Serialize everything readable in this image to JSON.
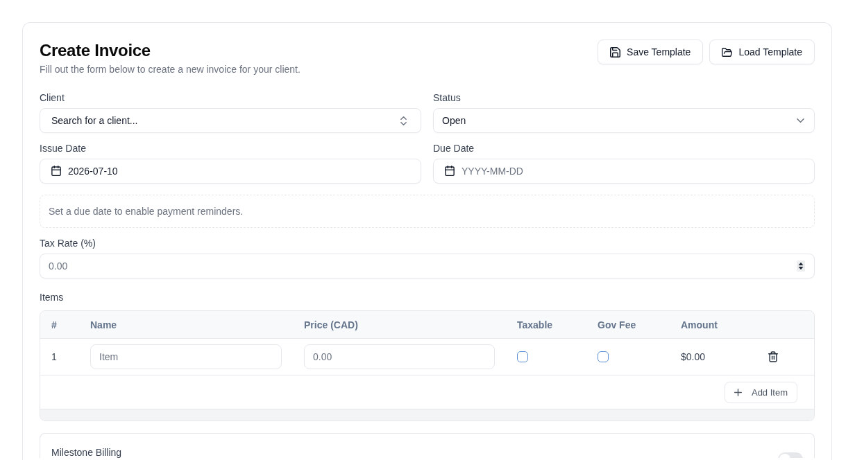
{
  "header": {
    "title": "Create Invoice",
    "subtitle": "Fill out the form below to create a new invoice for your client.",
    "actions": [
      {
        "kind": "save",
        "label": "Save Template"
      },
      {
        "kind": "load",
        "label": "Load Template"
      }
    ]
  },
  "fields": [
    {
      "kind": "combobox",
      "label": "Client",
      "value": "Search for a client..."
    },
    {
      "kind": "select",
      "label": "Status",
      "value": "Open"
    },
    {
      "kind": "date",
      "label": "Issue Date",
      "value": "2026-07-10"
    },
    {
      "kind": "date",
      "label": "Due Date",
      "placeholder": "YYYY-MM-DD"
    }
  ],
  "notice": "Set a due date to enable payment reminders.",
  "tax_rate": {
    "kind": "number",
    "label": "Tax Rate (%)",
    "placeholder": "0.00"
  },
  "items": {
    "label": "Items",
    "columns": [
      "#",
      "Name",
      "Price (CAD)",
      "Taxable",
      "Gov Fee",
      "Amount"
    ],
    "rows": [
      {
        "number": "1",
        "name": {
          "placeholder": "Item"
        },
        "price": {
          "placeholder": "0.00"
        },
        "taxable": false,
        "gov_fee": false,
        "amount": "$0.00"
      }
    ],
    "add_button": "Add Item"
  },
  "milestone_billing": {
    "label": "Milestone Billing",
    "on": false
  }
}
